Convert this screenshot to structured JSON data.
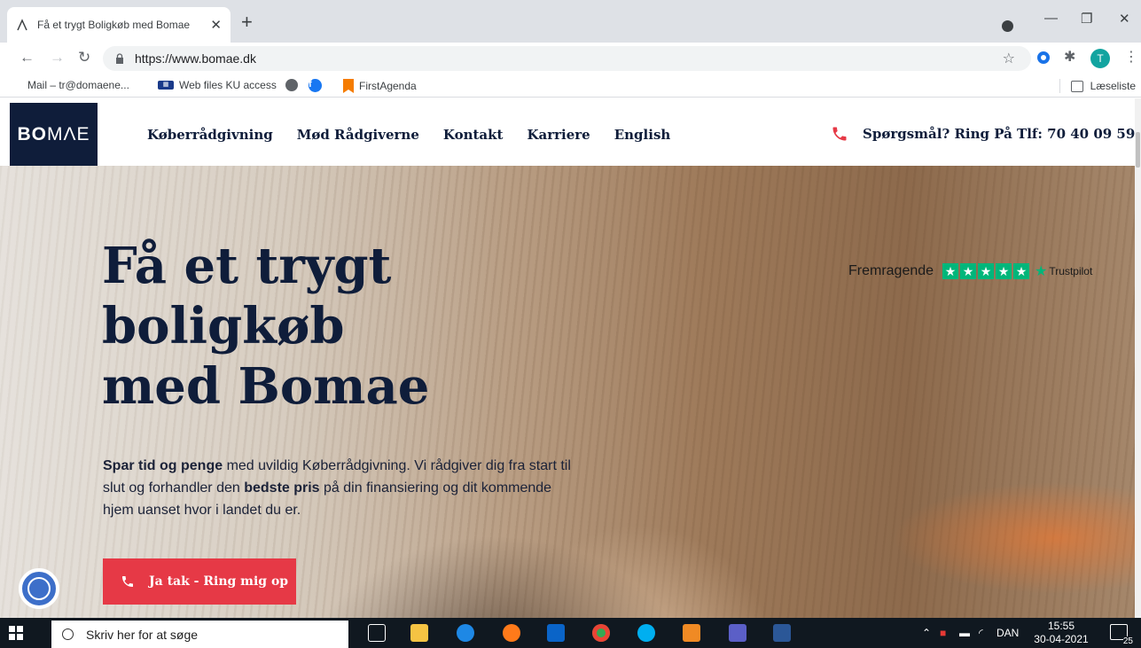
{
  "browser": {
    "tab_title": "Få et trygt Boligkøb med Bomae",
    "url": "https://www.bomae.dk",
    "avatar_letter": "T",
    "bookmarks": [
      {
        "label": "Mail – tr@domaene...",
        "icon": "microsoft-logo-icon"
      },
      {
        "label": "Web files KU access",
        "icon": "keyboard-icon"
      },
      {
        "label": "",
        "icon": "globe-icon"
      },
      {
        "label": "",
        "icon": "facebook-icon"
      },
      {
        "label": "FirstAgenda",
        "icon": "firstagenda-icon"
      }
    ],
    "reading_list": "Læseliste"
  },
  "site": {
    "logo_bold": "BO",
    "logo_light": "MΛE",
    "nav": [
      "Køberrådgivning",
      "Mød Rådgiverne",
      "Kontakt",
      "Karriere",
      "English"
    ],
    "phone_text": "Spørgsmål? Ring På Tlf: 70 40 09 59",
    "headline": [
      "Få et trygt",
      "boligkøb",
      "med Bomae"
    ],
    "lead": {
      "b1": "Spar tid og penge",
      "t1": " med uvildig Køberrådgivning. Vi rådgiver dig fra start til slut og forhandler den ",
      "b2": "bedste pris",
      "t2": " på din finansiering og dit kommende hjem uanset hvor i landet du er."
    },
    "cta_label": "Ja tak - Ring mig op",
    "trustpilot": {
      "label": "Fremragende",
      "brand": "Trustpilot",
      "stars": 5
    },
    "colors": {
      "navy": "#0f1d3a",
      "accent_red": "#e63946",
      "trustpilot_green": "#00b67a"
    }
  },
  "taskbar": {
    "search_placeholder": "Skriv her for at søge",
    "language": "DAN",
    "time": "15:55",
    "date": "30-04-2021",
    "notification_count": "25"
  }
}
